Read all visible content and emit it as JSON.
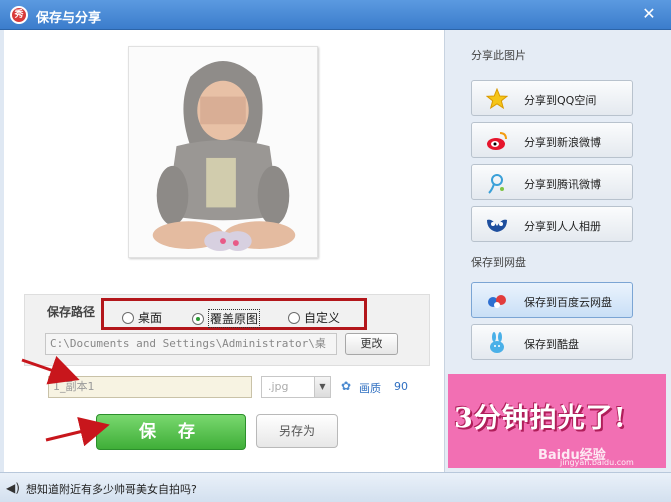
{
  "window": {
    "title": "保存与分享",
    "app_icon_text": "秀",
    "close_glyph": "✕"
  },
  "save": {
    "path_label": "保存路径",
    "options": [
      {
        "label": "桌面",
        "checked": false
      },
      {
        "label": "覆盖原图",
        "checked": true
      },
      {
        "label": "自定义",
        "checked": false
      }
    ],
    "path_value": "C:\\Documents and Settings\\Administrator\\桌",
    "change_button": "更改",
    "filename_value": "1_副本1",
    "format_value": ".jpg",
    "quality_label": "画质",
    "quality_value": "90",
    "save_button": "保 存",
    "save_as_button": "另存为"
  },
  "share": {
    "section_title": "分享此图片",
    "items": [
      {
        "label": "分享到QQ空间",
        "icon": "qzone-star-icon"
      },
      {
        "label": "分享到新浪微博",
        "icon": "sina-weibo-icon"
      },
      {
        "label": "分享到腾讯微博",
        "icon": "tencent-weibo-icon"
      },
      {
        "label": "分享到人人相册",
        "icon": "renren-icon"
      }
    ]
  },
  "cloud": {
    "section_title": "保存到网盘",
    "items": [
      {
        "label": "保存到百度云网盘",
        "icon": "baidu-cloud-icon"
      },
      {
        "label": "保存到酷盘",
        "icon": "kupan-rabbit-icon"
      }
    ]
  },
  "ad": {
    "text": "3分钟拍光了!",
    "watermark": "Baidu经验",
    "watermark_url": "jingyan.baidu.com"
  },
  "status": {
    "text": "想知道附近有多少帅哥美女自拍吗?"
  },
  "colors": {
    "titlebar": "#3b7dcc",
    "save_green": "#3fae38",
    "highlight_red": "#b3161b",
    "ad_pink": "#f26fb3",
    "link_blue": "#2f6fc1"
  }
}
